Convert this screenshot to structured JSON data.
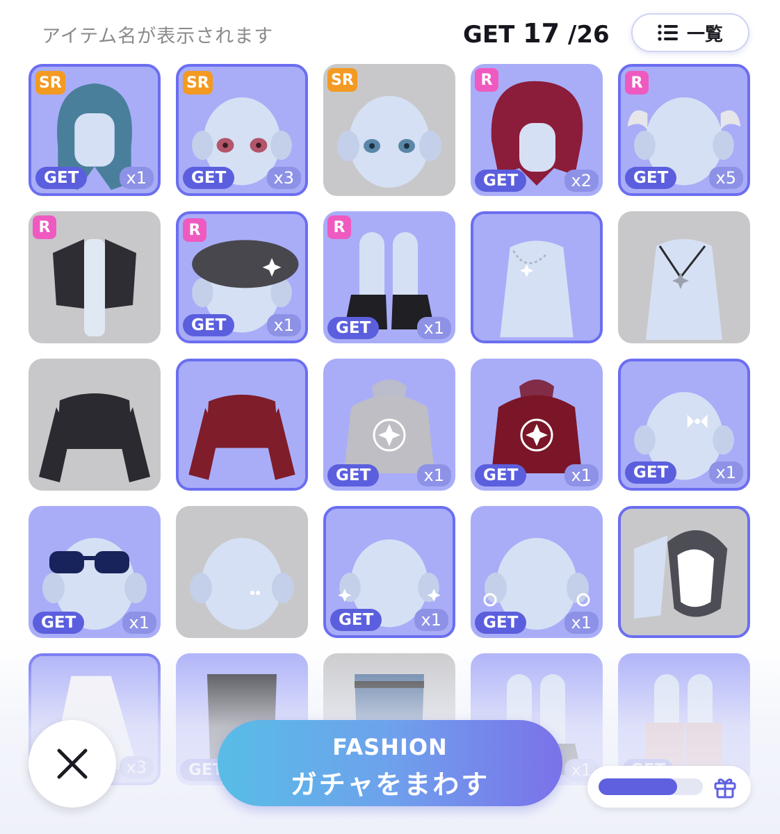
{
  "header": {
    "item_name_placeholder": "アイテム名が表示されます",
    "get_label": "GET",
    "get_owned": "17",
    "get_total": "/26",
    "list_button_label": "一覧"
  },
  "items": [
    {
      "id": "hair-blue-bob",
      "rarity": "SR",
      "get": "GET",
      "qty": "x1",
      "owned": true,
      "border": true
    },
    {
      "id": "eyes-pink",
      "rarity": "SR",
      "get": "GET",
      "qty": "x3",
      "owned": true,
      "border": true
    },
    {
      "id": "eyes-blue",
      "rarity": "SR",
      "get": "",
      "qty": "",
      "owned": false,
      "border": false
    },
    {
      "id": "hair-red",
      "rarity": "R",
      "get": "GET",
      "qty": "x2",
      "owned": true,
      "border": false
    },
    {
      "id": "hair-pigtails",
      "rarity": "R",
      "get": "GET",
      "qty": "x5",
      "owned": true,
      "border": true
    },
    {
      "id": "jacket-black",
      "rarity": "R",
      "get": "",
      "qty": "",
      "owned": false,
      "border": false
    },
    {
      "id": "beret",
      "rarity": "R",
      "get": "GET",
      "qty": "x1",
      "owned": true,
      "border": true
    },
    {
      "id": "boots",
      "rarity": "R",
      "get": "GET",
      "qty": "x1",
      "owned": true,
      "border": false
    },
    {
      "id": "necklace-star",
      "rarity": "",
      "get": "",
      "qty": "",
      "owned": true,
      "border": true
    },
    {
      "id": "necklace-pendant",
      "rarity": "",
      "get": "",
      "qty": "",
      "owned": false,
      "border": false
    },
    {
      "id": "crop-black",
      "rarity": "",
      "get": "",
      "qty": "",
      "owned": false,
      "border": false
    },
    {
      "id": "crop-red",
      "rarity": "",
      "get": "",
      "qty": "",
      "owned": true,
      "border": true
    },
    {
      "id": "hoodie-grey",
      "rarity": "",
      "get": "GET",
      "qty": "x1",
      "owned": true,
      "border": false
    },
    {
      "id": "hoodie-red",
      "rarity": "",
      "get": "GET",
      "qty": "x1",
      "owned": true,
      "border": false
    },
    {
      "id": "hair-ribbon",
      "rarity": "",
      "get": "GET",
      "qty": "x1",
      "owned": true,
      "border": true
    },
    {
      "id": "sunglasses",
      "rarity": "",
      "get": "GET",
      "qty": "x1",
      "owned": true,
      "border": false
    },
    {
      "id": "piercing",
      "rarity": "",
      "get": "",
      "qty": "",
      "owned": false,
      "border": false
    },
    {
      "id": "earrings-bow",
      "rarity": "",
      "get": "GET",
      "qty": "x1",
      "owned": true,
      "border": true
    },
    {
      "id": "earrings-star",
      "rarity": "",
      "get": "GET",
      "qty": "x1",
      "owned": true,
      "border": false
    },
    {
      "id": "frill-collar",
      "rarity": "",
      "get": "",
      "qty": "",
      "owned": false,
      "border": true
    },
    {
      "id": "dress-white",
      "rarity": "",
      "get": "",
      "qty": "x3",
      "owned": true,
      "border": true
    },
    {
      "id": "pants-black",
      "rarity": "",
      "get": "GET",
      "qty": "",
      "owned": true,
      "border": false
    },
    {
      "id": "jeans",
      "rarity": "",
      "get": "",
      "qty": "",
      "owned": false,
      "border": false
    },
    {
      "id": "shoes-black",
      "rarity": "",
      "get": "",
      "qty": "x1",
      "owned": true,
      "border": false
    },
    {
      "id": "socks-pink",
      "rarity": "",
      "get": "GET",
      "qty": "",
      "owned": true,
      "border": false
    }
  ],
  "footer": {
    "gacha_line1": "FASHION",
    "gacha_line2": "ガチャをまわす",
    "progress": 0.75
  },
  "colors": {
    "owned_tile": "#a9adf8",
    "locked_tile": "#c8c8ca",
    "accent": "#5b5fdd",
    "sr_badge": "#f39a23",
    "r_badge": "#ef5ac0"
  }
}
